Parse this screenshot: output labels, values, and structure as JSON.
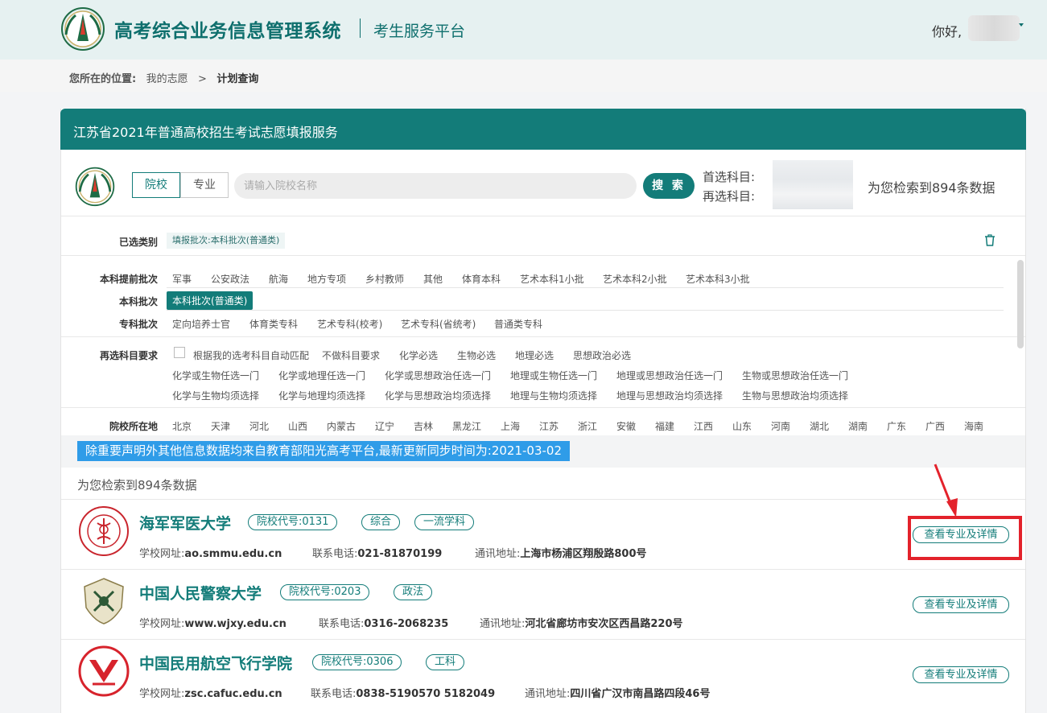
{
  "header": {
    "system_title": "高考综合业务信息管理系统",
    "platform_title": "考生服务平台",
    "greeting": "你好,"
  },
  "breadcrumb": {
    "label": "您所在的位置:",
    "parent": "我的志愿",
    "separator": ">",
    "current": "计划查询"
  },
  "panel": {
    "title": "江苏省2021年普通高校招生考试志愿填报服务"
  },
  "search": {
    "tab_school": "院校",
    "tab_major": "专业",
    "placeholder": "请输入院校名称",
    "button": "搜 索",
    "first_subject_label": "首选科目:",
    "second_subject_label": "再选科目:",
    "result_count": "为您检索到894条数据"
  },
  "filters": {
    "selected_label": "已选类别",
    "selected_chip": "填报批次:本科批次(普通类)",
    "early_label": "本科提前批次",
    "early_options": [
      "军事",
      "公安政法",
      "航海",
      "地方专项",
      "乡村教师",
      "其他",
      "体育本科",
      "艺术本科1小批",
      "艺术本科2小批",
      "艺术本科3小批"
    ],
    "undergrad_label": "本科批次",
    "undergrad_option": "本科批次(普通类)",
    "junior_label": "专科批次",
    "junior_options": [
      "定向培养士官",
      "体育类专科",
      "艺术专科(校考)",
      "艺术专科(省统考)",
      "普通类专科"
    ],
    "subject_label": "再选科目要求",
    "subject_row1": [
      "根据我的选考科目自动匹配",
      "不做科目要求",
      "化学必选",
      "生物必选",
      "地理必选",
      "思想政治必选"
    ],
    "subject_row2": [
      "化学或生物任选一门",
      "化学或地理任选一门",
      "化学或思想政治任选一门",
      "地理或生物任选一门",
      "地理或思想政治任选一门",
      "生物或思想政治任选一门"
    ],
    "subject_row3": [
      "化学与生物均须选择",
      "化学与地理均须选择",
      "化学与思想政治均须选择",
      "地理与生物均须选择",
      "地理与思想政治均须选择",
      "生物与思想政治均须选择"
    ],
    "location_label": "院校所在地",
    "locations": [
      "北京",
      "天津",
      "河北",
      "山西",
      "内蒙古",
      "辽宁",
      "吉林",
      "黑龙江",
      "上海",
      "江苏",
      "浙江",
      "安徽",
      "福建",
      "江西",
      "山东",
      "河南",
      "湖北",
      "湖南",
      "广东",
      "广西",
      "海南"
    ]
  },
  "notice": "除重要声明外其他信息数据均来自教育部阳光高考平台,最新更新同步时间为:2021-03-02",
  "result_count": "为您检索到894条数据",
  "schools": [
    {
      "name": "海军军医大学",
      "code_tag": "院校代号:0131",
      "tags": [
        "综合",
        "一流学科"
      ],
      "web_label": "学校网址:",
      "web": "ao.smmu.edu.cn",
      "phone_label": "联系电话:",
      "phone": "021-81870199",
      "addr_label": "通讯地址:",
      "addr": "上海市杨浦区翔殷路800号",
      "button": "查看专业及详情"
    },
    {
      "name": "中国人民警察大学",
      "code_tag": "院校代号:0203",
      "tags": [
        "政法"
      ],
      "web_label": "学校网址:",
      "web": "www.wjxy.edu.cn",
      "phone_label": "联系电话:",
      "phone": "0316-2068235",
      "addr_label": "通讯地址:",
      "addr": "河北省廊坊市安次区西昌路220号",
      "button": "查看专业及详情"
    },
    {
      "name": "中国民用航空飞行学院",
      "code_tag": "院校代号:0306",
      "tags": [
        "工科"
      ],
      "web_label": "学校网址:",
      "web": "zsc.cafuc.edu.cn",
      "phone_label": "联系电话:",
      "phone": "0838-5190570 5182049",
      "addr_label": "通讯地址:",
      "addr": "四川省广汉市南昌路四段46号",
      "button": "查看专业及详情"
    }
  ],
  "colors": {
    "brand": "#137c79",
    "notice": "#2f9ce8",
    "highlight": "#e3222b"
  }
}
